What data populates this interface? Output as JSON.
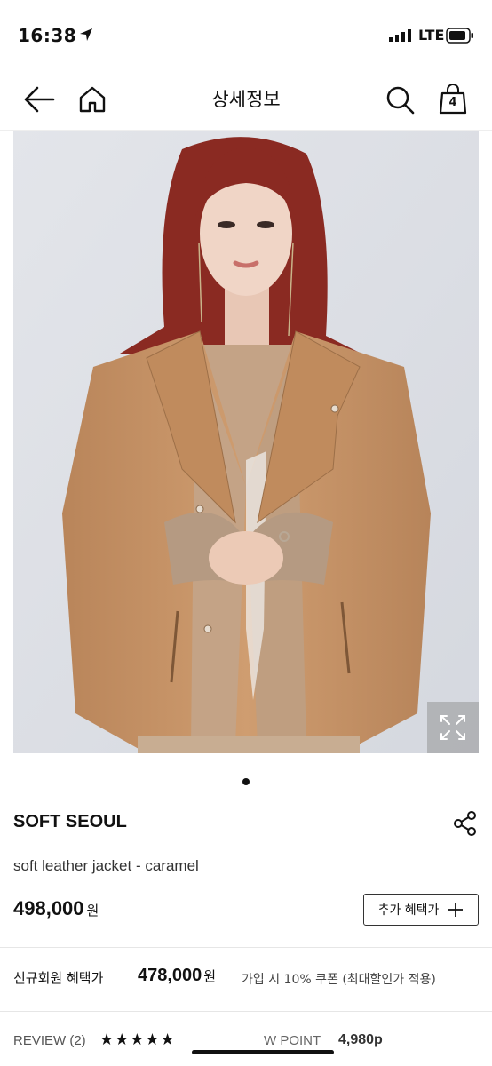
{
  "status_bar": {
    "time": "16:38",
    "network": "LTE"
  },
  "header": {
    "title": "상세정보",
    "cart_count": "4"
  },
  "product": {
    "brand": "SOFT SEOUL",
    "name": "soft leather jacket - caramel",
    "price": "498,000",
    "currency": "원",
    "benefit_button": "추가 혜택가"
  },
  "member": {
    "label": "신규회원 혜택가",
    "price": "478,000",
    "currency": "원",
    "coupon_text": "가입 시 10% 쿠폰 (최대할인가 적용)"
  },
  "footer": {
    "review": "REVIEW (2)",
    "rating": 5,
    "stars": "★★★★★",
    "wpoint_label": "W POINT",
    "wpoint_value": "4,980p"
  },
  "colors": {
    "accent": "#111111",
    "photo_bg": "#dfe2e8",
    "jacket": "#c69568",
    "hair": "#8a2a22"
  },
  "icons": [
    "location-arrow-icon",
    "signal-icon",
    "battery-icon",
    "back-arrow-icon",
    "home-icon",
    "search-icon",
    "cart-icon",
    "expand-icon",
    "share-icon",
    "plus-icon"
  ]
}
